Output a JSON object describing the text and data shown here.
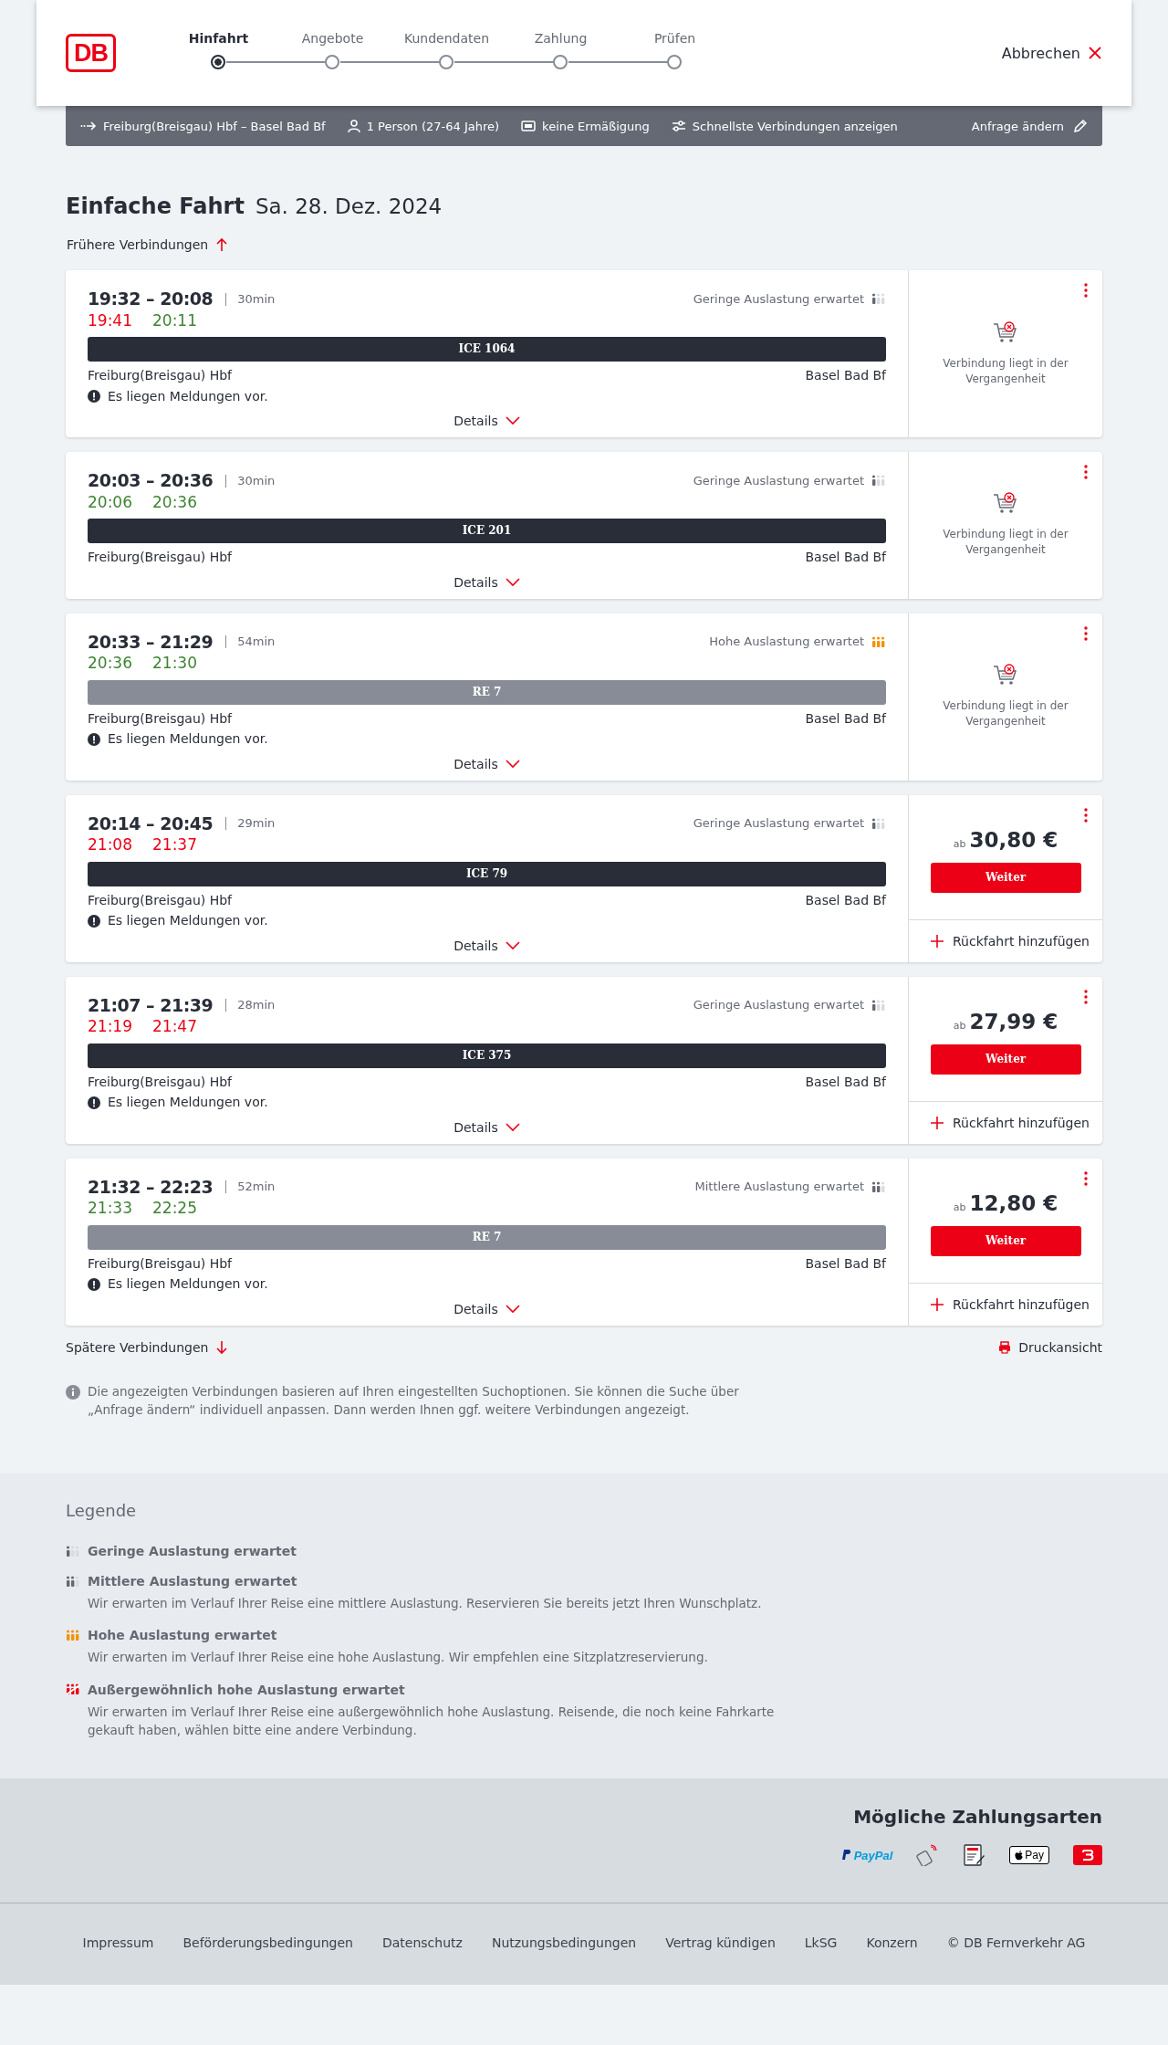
{
  "header": {
    "logo": "DB",
    "steps": [
      {
        "label": "Hinfahrt",
        "selected": true
      },
      {
        "label": "Angebote",
        "selected": false
      },
      {
        "label": "Kundendaten",
        "selected": false
      },
      {
        "label": "Zahlung",
        "selected": false
      },
      {
        "label": "Prüfen",
        "selected": false
      }
    ],
    "cancel": "Abbrechen"
  },
  "search_bar": {
    "items": [
      {
        "kind": "route",
        "text": "Freiburg(Breisgau) Hbf – Basel Bad Bf"
      },
      {
        "kind": "person",
        "text": "1 Person (27-64 Jahre)"
      },
      {
        "kind": "card",
        "text": "keine Ermäßigung"
      },
      {
        "kind": "filter",
        "text": "Schnellste Verbindungen anzeigen"
      }
    ],
    "edit": "Anfrage ändern"
  },
  "heading": {
    "title": "Einfache Fahrt",
    "date": "Sa. 28. Dez. 2024"
  },
  "earlier": "Frühere Verbindungen",
  "connections": [
    {
      "times": "19:32 – 20:08",
      "duration": "30min",
      "realtime": [
        {
          "time": "19:41",
          "delayed": true
        },
        {
          "time": "20:11",
          "delayed": false
        }
      ],
      "occupancy": {
        "kind": "low",
        "text": "Geringe Auslastung erwartet"
      },
      "train": {
        "kind": "long_distance",
        "label": "ICE 1064"
      },
      "from": "Freiburg(Breisgau) Hbf",
      "to": "Basel Bad Bf",
      "notice": "Es liegen Meldungen vor.",
      "details": "Details",
      "offer": {
        "kind": "past",
        "text": "Verbindung liegt in der Vergangenheit"
      }
    },
    {
      "times": "20:03 – 20:36",
      "duration": "30min",
      "realtime": [
        {
          "time": "20:06",
          "delayed": false
        },
        {
          "time": "20:36",
          "delayed": false
        }
      ],
      "occupancy": {
        "kind": "low",
        "text": "Geringe Auslastung erwartet"
      },
      "train": {
        "kind": "long_distance",
        "label": "ICE 201"
      },
      "from": "Freiburg(Breisgau) Hbf",
      "to": "Basel Bad Bf",
      "details": "Details",
      "offer": {
        "kind": "past",
        "text": "Verbindung liegt in der Vergangenheit"
      }
    },
    {
      "times": "20:33 – 21:29",
      "duration": "54min",
      "realtime": [
        {
          "time": "20:36",
          "delayed": false
        },
        {
          "time": "21:30",
          "delayed": false
        }
      ],
      "occupancy": {
        "kind": "high",
        "text": "Hohe Auslastung erwartet"
      },
      "train": {
        "kind": "regional",
        "label": "RE 7"
      },
      "from": "Freiburg(Breisgau) Hbf",
      "to": "Basel Bad Bf",
      "notice": "Es liegen Meldungen vor.",
      "details": "Details",
      "offer": {
        "kind": "past",
        "text": "Verbindung liegt in der Vergangenheit"
      }
    },
    {
      "times": "20:14 – 20:45",
      "duration": "29min",
      "realtime": [
        {
          "time": "21:08",
          "delayed": true
        },
        {
          "time": "21:37",
          "delayed": true
        }
      ],
      "occupancy": {
        "kind": "low",
        "text": "Geringe Auslastung erwartet"
      },
      "train": {
        "kind": "long_distance",
        "label": "ICE 79"
      },
      "from": "Freiburg(Breisgau) Hbf",
      "to": "Basel Bad Bf",
      "notice": "Es liegen Meldungen vor.",
      "details": "Details",
      "offer": {
        "kind": "price",
        "prefix": "ab",
        "price": "30,80 €",
        "button": "Weiter",
        "return": "Rückfahrt hinzufügen"
      }
    },
    {
      "times": "21:07 – 21:39",
      "duration": "28min",
      "realtime": [
        {
          "time": "21:19",
          "delayed": true
        },
        {
          "time": "21:47",
          "delayed": true
        }
      ],
      "occupancy": {
        "kind": "low",
        "text": "Geringe Auslastung erwartet"
      },
      "train": {
        "kind": "long_distance",
        "label": "ICE 375"
      },
      "from": "Freiburg(Breisgau) Hbf",
      "to": "Basel Bad Bf",
      "notice": "Es liegen Meldungen vor.",
      "details": "Details",
      "offer": {
        "kind": "price",
        "prefix": "ab",
        "price": "27,99 €",
        "button": "Weiter",
        "return": "Rückfahrt hinzufügen"
      }
    },
    {
      "times": "21:32 – 22:23",
      "duration": "52min",
      "realtime": [
        {
          "time": "21:33",
          "delayed": false
        },
        {
          "time": "22:25",
          "delayed": false
        }
      ],
      "occupancy": {
        "kind": "medium",
        "text": "Mittlere Auslastung erwartet"
      },
      "train": {
        "kind": "regional",
        "label": "RE 7"
      },
      "from": "Freiburg(Breisgau) Hbf",
      "to": "Basel Bad Bf",
      "notice": "Es liegen Meldungen vor.",
      "details": "Details",
      "offer": {
        "kind": "price",
        "prefix": "ab",
        "price": "12,80 €",
        "button": "Weiter",
        "return": "Rückfahrt hinzufügen"
      }
    }
  ],
  "later": "Spätere Verbindungen",
  "print": "Druckansicht",
  "info": "Die angezeigten Verbindungen basieren auf Ihren eingestellten Suchoptionen. Sie können die Suche über „Anfrage ändern“ individuell anpassen. Dann werden Ihnen ggf. weitere Verbindungen angezeigt.",
  "legend": {
    "title": "Legende",
    "items": [
      {
        "kind": "low",
        "title": "Geringe Auslastung erwartet"
      },
      {
        "kind": "medium",
        "title": "Mittlere Auslastung erwartet",
        "text": "Wir erwarten im Verlauf Ihrer Reise eine mittlere Auslastung. Reservieren Sie bereits jetzt Ihren Wunschplatz."
      },
      {
        "kind": "high",
        "title": "Hohe Auslastung erwartet",
        "text": "Wir erwarten im Verlauf Ihrer Reise eine hohe Auslastung. Wir empfehlen eine Sitzplatzreservierung."
      },
      {
        "kind": "extreme",
        "title": "Außergewöhnlich hohe Auslastung erwartet",
        "text": "Wir erwarten im Verlauf Ihrer Reise eine außergewöhnlich hohe Auslastung. Reisende, die noch keine Fahrkarte gekauft haben, wählen bitte eine andere Verbindung."
      }
    ]
  },
  "payment": {
    "title": "Mögliche Zahlungsarten",
    "methods": [
      {
        "kind": "paypal",
        "label": "PayPal"
      },
      {
        "kind": "contactless"
      },
      {
        "kind": "sepa"
      },
      {
        "kind": "applepay",
        "label": "Pay"
      },
      {
        "kind": "bonus"
      }
    ]
  },
  "footer": {
    "links": [
      "Impressum",
      "Beförderungsbedingungen",
      "Datenschutz",
      "Nutzungsbedingungen",
      "Vertrag kündigen",
      "LkSG",
      "Konzern",
      "© DB Fernverkehr AG"
    ]
  }
}
